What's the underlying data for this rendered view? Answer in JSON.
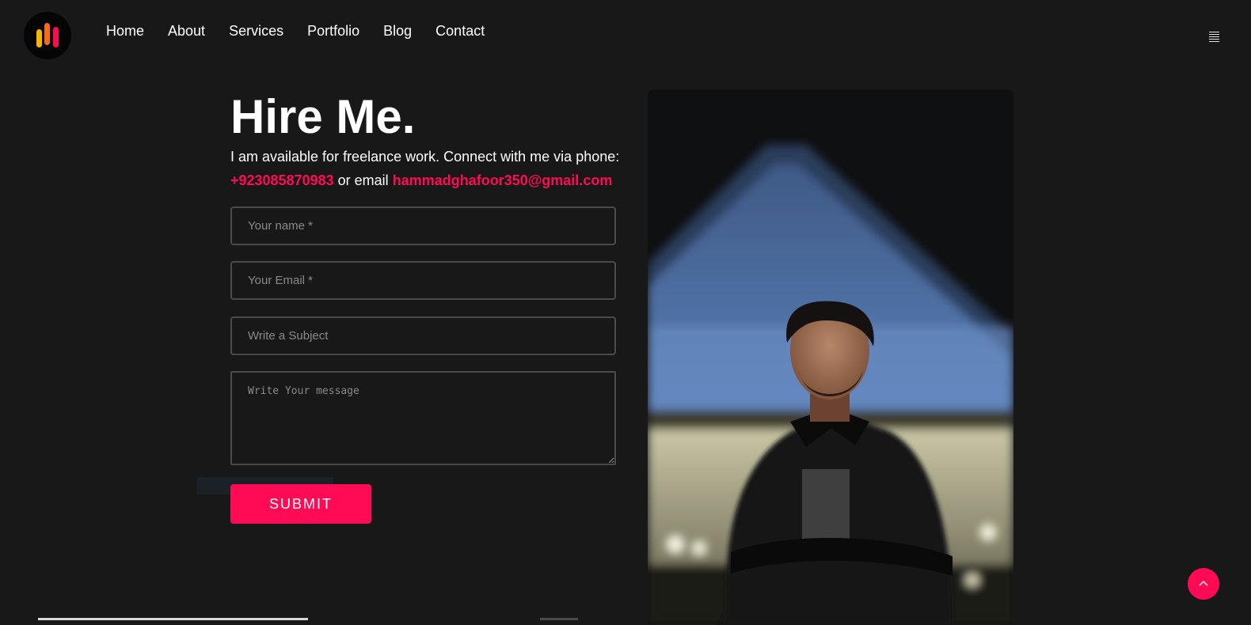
{
  "nav": {
    "items": [
      "Home",
      "About",
      "Services",
      "Portfolio",
      "Blog",
      "Contact"
    ]
  },
  "hero": {
    "title": "Hire Me.",
    "intro": "I am available for freelance work. Connect with me via phone:",
    "phone": "+923085870983",
    "connector": "or email",
    "email": "hammadghafoor350@gmail.com"
  },
  "form": {
    "name_placeholder": "Your name *",
    "email_placeholder": "Your Email *",
    "subject_placeholder": "Write a Subject",
    "message_placeholder": "Write Your message",
    "submit_label": "SUBMIT"
  },
  "icons": {
    "logo": "logo-bars-icon",
    "menu": "hamburger-menu-icon",
    "back_to_top": "chevron-up-icon"
  },
  "colors": {
    "background": "#181818",
    "accent": "#ff0a54",
    "logo_yellow": "#f7b500",
    "logo_orange": "#f66a1a",
    "text": "#ffffff"
  }
}
